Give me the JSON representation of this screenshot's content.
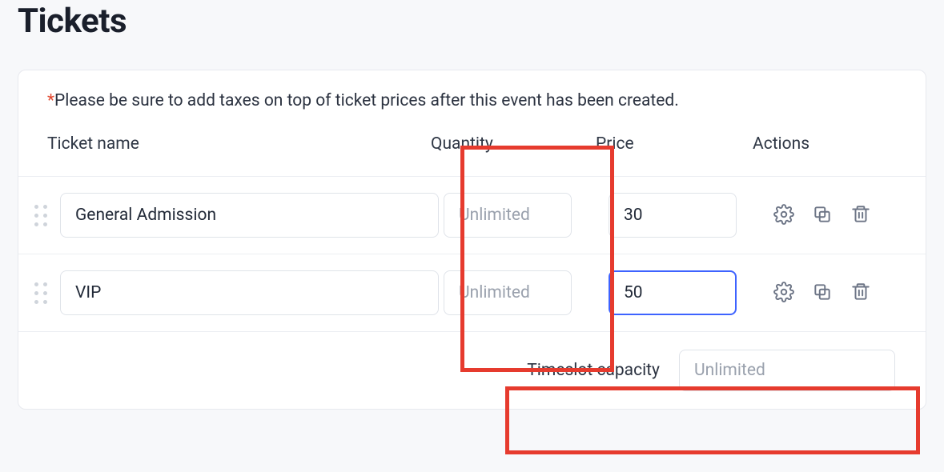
{
  "page": {
    "title": "Tickets"
  },
  "note": {
    "asterisk": "*",
    "text": "Please be sure to add taxes on top of ticket prices after this event has been created."
  },
  "headers": {
    "name": "Ticket name",
    "quantity": "Quantity",
    "price": "Price",
    "actions": "Actions"
  },
  "rows": [
    {
      "name": "General Admission",
      "quantity": "",
      "quantity_placeholder": "Unlimited",
      "price": "30",
      "price_focused": false
    },
    {
      "name": "VIP",
      "quantity": "",
      "quantity_placeholder": "Unlimited",
      "price": "50",
      "price_focused": true
    }
  ],
  "footer": {
    "capacity_label": "Timeslot capacity",
    "capacity_value": "",
    "capacity_placeholder": "Unlimited"
  },
  "icons": {
    "settings": "gear-icon",
    "duplicate": "duplicate-icon",
    "delete": "trash-icon",
    "drag": "drag-handle-icon"
  },
  "colors": {
    "accent_focus": "#3e63ff",
    "callout": "#e63b2e",
    "asterisk": "#e1472f"
  }
}
